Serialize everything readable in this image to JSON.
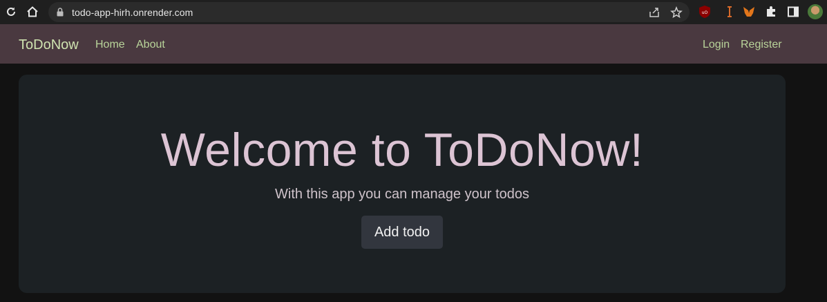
{
  "browser": {
    "url": "todo-app-hirh.onrender.com",
    "icons": [
      "reload-icon",
      "home-icon",
      "lock-icon",
      "share-icon",
      "bookmark-star-icon",
      "ublock-icon",
      "extension-i-icon",
      "metamask-icon",
      "puzzle-icon",
      "sidepanel-icon",
      "profile-avatar"
    ]
  },
  "navbar": {
    "brand": "ToDoNow",
    "links": {
      "home": "Home",
      "about": "About",
      "login": "Login",
      "register": "Register"
    },
    "background": "#4a3940",
    "link_color": "#b9d49a"
  },
  "hero": {
    "title": "Welcome to ToDoNow!",
    "subtitle": "With this app you can manage your todos",
    "button": "Add todo",
    "background": "#1c2124"
  }
}
